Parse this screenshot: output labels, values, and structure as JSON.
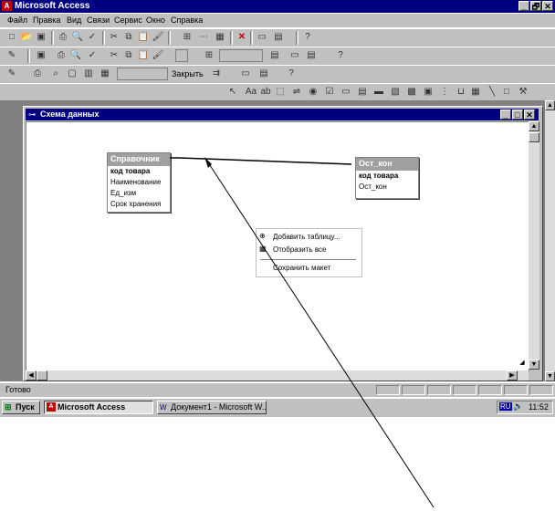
{
  "app": {
    "title": "Microsoft Access",
    "window_controls": [
      "_",
      "🗗",
      "✕"
    ]
  },
  "menu": [
    {
      "label": "Файл"
    },
    {
      "label": "Правка"
    },
    {
      "label": "Вид"
    },
    {
      "label": "Связи"
    },
    {
      "label": "Сервис"
    },
    {
      "label": "Окно"
    },
    {
      "label": "Справка"
    }
  ],
  "toolbar3": {
    "close_label": "Закрыть"
  },
  "mdi": {
    "title": "Схема данных",
    "controls": [
      "_",
      "□",
      "✕"
    ]
  },
  "tables": [
    {
      "name": "Справочник",
      "fields": [
        "код товара",
        "Наименование",
        "Ед_изм",
        "Срок хранения"
      ]
    },
    {
      "name": "Ост_кон",
      "fields": [
        "код товара",
        "Ост_кон"
      ]
    }
  ],
  "context_menu": {
    "items": [
      "Добавить таблицу...",
      "Отобразить все",
      "Сохранить макет"
    ]
  },
  "status": {
    "text": "Готово"
  },
  "taskbar": {
    "start": "Пуск",
    "tasks": [
      "Microsoft Access",
      "Документ1 - Microsoft W..."
    ],
    "lang": "RU",
    "clock": "11:52"
  }
}
